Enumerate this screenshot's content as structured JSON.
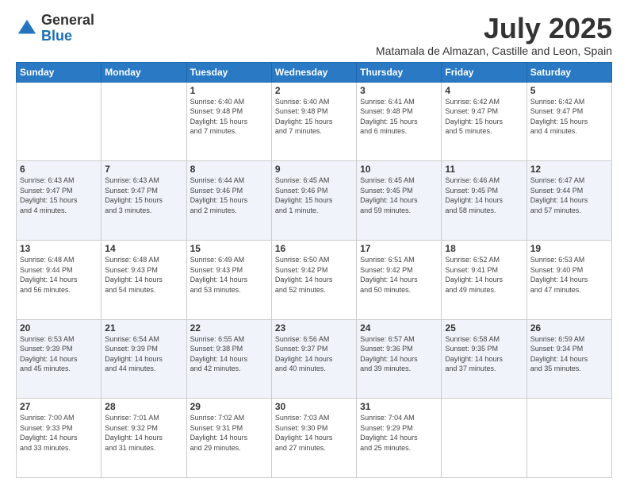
{
  "logo": {
    "general": "General",
    "blue": "Blue"
  },
  "header": {
    "month": "July 2025",
    "location": "Matamala de Almazan, Castille and Leon, Spain"
  },
  "weekdays": [
    "Sunday",
    "Monday",
    "Tuesday",
    "Wednesday",
    "Thursday",
    "Friday",
    "Saturday"
  ],
  "weeks": [
    [
      {
        "day": "",
        "info": ""
      },
      {
        "day": "",
        "info": ""
      },
      {
        "day": "1",
        "info": "Sunrise: 6:40 AM\nSunset: 9:48 PM\nDaylight: 15 hours\nand 7 minutes."
      },
      {
        "day": "2",
        "info": "Sunrise: 6:40 AM\nSunset: 9:48 PM\nDaylight: 15 hours\nand 7 minutes."
      },
      {
        "day": "3",
        "info": "Sunrise: 6:41 AM\nSunset: 9:48 PM\nDaylight: 15 hours\nand 6 minutes."
      },
      {
        "day": "4",
        "info": "Sunrise: 6:42 AM\nSunset: 9:47 PM\nDaylight: 15 hours\nand 5 minutes."
      },
      {
        "day": "5",
        "info": "Sunrise: 6:42 AM\nSunset: 9:47 PM\nDaylight: 15 hours\nand 4 minutes."
      }
    ],
    [
      {
        "day": "6",
        "info": "Sunrise: 6:43 AM\nSunset: 9:47 PM\nDaylight: 15 hours\nand 4 minutes."
      },
      {
        "day": "7",
        "info": "Sunrise: 6:43 AM\nSunset: 9:47 PM\nDaylight: 15 hours\nand 3 minutes."
      },
      {
        "day": "8",
        "info": "Sunrise: 6:44 AM\nSunset: 9:46 PM\nDaylight: 15 hours\nand 2 minutes."
      },
      {
        "day": "9",
        "info": "Sunrise: 6:45 AM\nSunset: 9:46 PM\nDaylight: 15 hours\nand 1 minute."
      },
      {
        "day": "10",
        "info": "Sunrise: 6:45 AM\nSunset: 9:45 PM\nDaylight: 14 hours\nand 59 minutes."
      },
      {
        "day": "11",
        "info": "Sunrise: 6:46 AM\nSunset: 9:45 PM\nDaylight: 14 hours\nand 58 minutes."
      },
      {
        "day": "12",
        "info": "Sunrise: 6:47 AM\nSunset: 9:44 PM\nDaylight: 14 hours\nand 57 minutes."
      }
    ],
    [
      {
        "day": "13",
        "info": "Sunrise: 6:48 AM\nSunset: 9:44 PM\nDaylight: 14 hours\nand 56 minutes."
      },
      {
        "day": "14",
        "info": "Sunrise: 6:48 AM\nSunset: 9:43 PM\nDaylight: 14 hours\nand 54 minutes."
      },
      {
        "day": "15",
        "info": "Sunrise: 6:49 AM\nSunset: 9:43 PM\nDaylight: 14 hours\nand 53 minutes."
      },
      {
        "day": "16",
        "info": "Sunrise: 6:50 AM\nSunset: 9:42 PM\nDaylight: 14 hours\nand 52 minutes."
      },
      {
        "day": "17",
        "info": "Sunrise: 6:51 AM\nSunset: 9:42 PM\nDaylight: 14 hours\nand 50 minutes."
      },
      {
        "day": "18",
        "info": "Sunrise: 6:52 AM\nSunset: 9:41 PM\nDaylight: 14 hours\nand 49 minutes."
      },
      {
        "day": "19",
        "info": "Sunrise: 6:53 AM\nSunset: 9:40 PM\nDaylight: 14 hours\nand 47 minutes."
      }
    ],
    [
      {
        "day": "20",
        "info": "Sunrise: 6:53 AM\nSunset: 9:39 PM\nDaylight: 14 hours\nand 45 minutes."
      },
      {
        "day": "21",
        "info": "Sunrise: 6:54 AM\nSunset: 9:39 PM\nDaylight: 14 hours\nand 44 minutes."
      },
      {
        "day": "22",
        "info": "Sunrise: 6:55 AM\nSunset: 9:38 PM\nDaylight: 14 hours\nand 42 minutes."
      },
      {
        "day": "23",
        "info": "Sunrise: 6:56 AM\nSunset: 9:37 PM\nDaylight: 14 hours\nand 40 minutes."
      },
      {
        "day": "24",
        "info": "Sunrise: 6:57 AM\nSunset: 9:36 PM\nDaylight: 14 hours\nand 39 minutes."
      },
      {
        "day": "25",
        "info": "Sunrise: 6:58 AM\nSunset: 9:35 PM\nDaylight: 14 hours\nand 37 minutes."
      },
      {
        "day": "26",
        "info": "Sunrise: 6:59 AM\nSunset: 9:34 PM\nDaylight: 14 hours\nand 35 minutes."
      }
    ],
    [
      {
        "day": "27",
        "info": "Sunrise: 7:00 AM\nSunset: 9:33 PM\nDaylight: 14 hours\nand 33 minutes."
      },
      {
        "day": "28",
        "info": "Sunrise: 7:01 AM\nSunset: 9:32 PM\nDaylight: 14 hours\nand 31 minutes."
      },
      {
        "day": "29",
        "info": "Sunrise: 7:02 AM\nSunset: 9:31 PM\nDaylight: 14 hours\nand 29 minutes."
      },
      {
        "day": "30",
        "info": "Sunrise: 7:03 AM\nSunset: 9:30 PM\nDaylight: 14 hours\nand 27 minutes."
      },
      {
        "day": "31",
        "info": "Sunrise: 7:04 AM\nSunset: 9:29 PM\nDaylight: 14 hours\nand 25 minutes."
      },
      {
        "day": "",
        "info": ""
      },
      {
        "day": "",
        "info": ""
      }
    ]
  ]
}
